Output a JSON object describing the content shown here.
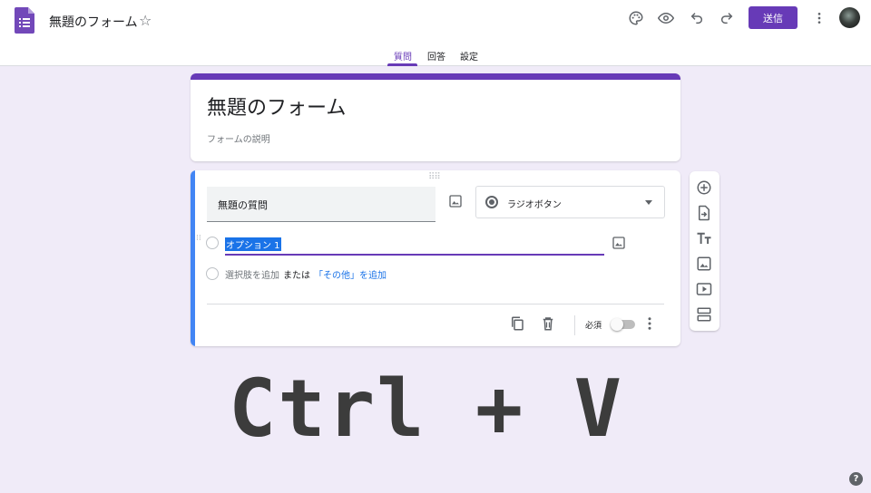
{
  "header": {
    "doc_title": "無題のフォーム",
    "star_icon": "star-outline-icon",
    "send_label": "送信",
    "icons": [
      "palette-icon",
      "preview-eye-icon",
      "undo-icon",
      "redo-icon",
      "more-vert-icon"
    ]
  },
  "tabs": [
    {
      "label": "質問",
      "active": true
    },
    {
      "label": "回答",
      "active": false
    },
    {
      "label": "設定",
      "active": false
    }
  ],
  "form": {
    "title": "無題のフォーム",
    "description_placeholder": "フォームの説明"
  },
  "question": {
    "title_placeholder": "無題の質問",
    "type_label": "ラジオボタン",
    "options": [
      {
        "label": "オプション 1"
      }
    ],
    "add_choice": "選択肢を追加",
    "or": "または",
    "add_other": "「その他」を追加",
    "required_label": "必須",
    "required": false
  },
  "side_tools": [
    "add-question-icon",
    "import-questions-icon",
    "add-title-icon",
    "add-image-icon",
    "add-video-icon",
    "add-section-icon"
  ],
  "overlay": {
    "shortcut": "Ctrl + V"
  },
  "colors": {
    "primary": "#673ab7",
    "accent_blue": "#4285f4",
    "background": "#f0ebf8",
    "link": "#1a73e8"
  }
}
